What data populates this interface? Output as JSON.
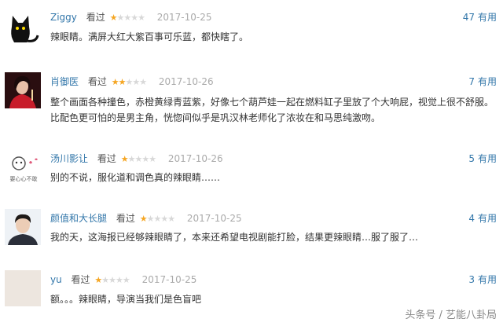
{
  "reviews": [
    {
      "name": "Ziggy",
      "seen_label": "看过",
      "rating": 1,
      "date": "2017-10-25",
      "useful_count": "47",
      "useful_label": "有用",
      "lines": [
        "辣眼睛。满屏大红大紫百事可乐蓝，都快瞎了。"
      ]
    },
    {
      "name": "肖御医",
      "seen_label": "看过",
      "rating": 2,
      "date": "2017-10-26",
      "useful_count": "7",
      "useful_label": "有用",
      "lines": [
        "整个画面各种撞色，赤橙黄绿青蓝紫，好像七个葫芦娃一起在燃料缸子里放了个大响屁，视觉上很不舒服。",
        "比配色更可怕的是男主角，恍惚间似乎是巩汉林老师化了浓妆在和马思纯激吻。"
      ]
    },
    {
      "name": "汤川影让",
      "seen_label": "看过",
      "rating": 1,
      "date": "2017-10-26",
      "useful_count": "5",
      "useful_label": "有用",
      "avatar_text": "要心心不敢",
      "lines": [
        "别的不说，服化道和调色真的辣眼睛……"
      ]
    },
    {
      "name": "颜值和大长腿",
      "seen_label": "看过",
      "rating": 1,
      "date": "2017-10-25",
      "useful_count": "4",
      "useful_label": "有用",
      "lines": [
        "我的天，这海报已经够辣眼睛了，本来还希望电视剧能打脸，结果更辣眼睛…服了服了…"
      ]
    },
    {
      "name": "yu",
      "seen_label": "看过",
      "rating": 1,
      "date": "2017-10-25",
      "useful_count": "3",
      "useful_label": "有用",
      "lines": [
        "额。。。辣眼睛，导演当我们是色盲吧"
      ]
    }
  ],
  "watermark": "头条号 / 艺能八卦局",
  "colors": {
    "link": "#3377aa",
    "star_on": "#f5a623",
    "star_off": "#d8d8d8",
    "date": "#aaaaaa"
  }
}
